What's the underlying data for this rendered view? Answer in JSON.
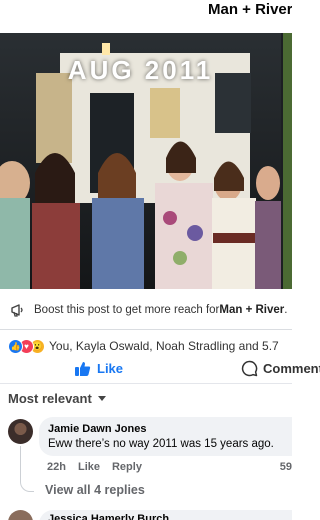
{
  "header": {
    "page_name": "Man + River"
  },
  "photo": {
    "caption": "AUG 2011"
  },
  "boost": {
    "prefix": "Boost this post to get more reach for ",
    "page_name": "Man + River",
    "suffix": "."
  },
  "reactions": {
    "text": "You, Kayla Oswald, Noah Stradling and 5.7"
  },
  "actions": {
    "like_label": "Like",
    "comment_label": "Comment"
  },
  "sort": {
    "label": "Most relevant"
  },
  "comments": [
    {
      "author": "Jamie Dawn Jones",
      "text": "Eww there’s no way 2011 was 15 years ago.",
      "time": "22h",
      "like_label": "Like",
      "reply_label": "Reply",
      "react_count": "59"
    }
  ],
  "view_replies": "View all 4 replies",
  "next_comment": {
    "author": "Jessica Hamerly Burch"
  },
  "colors": {
    "accent": "#1877f2",
    "muted": "#65676b",
    "bubble": "#f0f2f5"
  }
}
